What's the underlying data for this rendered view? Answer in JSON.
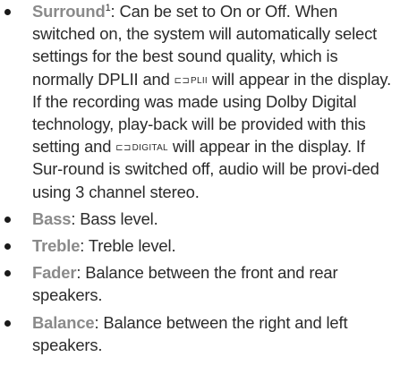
{
  "items": [
    {
      "term": "Surround",
      "sup": "1",
      "parts": [
        ": Can be set to On or Off. When switched on, the system will automatically select settings for the best sound quality, which is normally DPLII and ",
        " will appear in the display. If the recording was made using Dolby Digital technology, play-back will be provided with this setting and ",
        " will appear in the display. If Sur-round is switched off, audio will be provi-ded using 3 channel stereo."
      ],
      "logo1": {
        "glyph": "⊏⊐",
        "text": "PLII"
      },
      "logo2": {
        "glyph": "⊏⊐",
        "text": "DIGITAL"
      }
    },
    {
      "term": "Bass",
      "rest": ": Bass level."
    },
    {
      "term": "Treble",
      "rest": ": Treble level."
    },
    {
      "term": "Fader",
      "rest": ": Balance between the front and rear speakers."
    },
    {
      "term": "Balance",
      "rest": ": Balance between the right and left speakers."
    }
  ]
}
